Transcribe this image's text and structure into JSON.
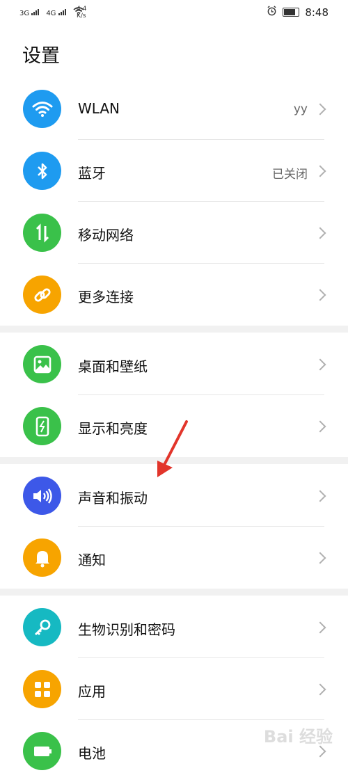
{
  "status_bar": {
    "net1": "3G",
    "net2": "4G",
    "speed_value": "4.4",
    "speed_unit": "K/s",
    "time": "8:48"
  },
  "page": {
    "title": "设置"
  },
  "rows": [
    {
      "label": "WLAN",
      "value": "yy",
      "icon": "wifi-icon",
      "color": "#1e9bf0"
    },
    {
      "label": "蓝牙",
      "value": "已关闭",
      "icon": "bluetooth-icon",
      "color": "#1e9bf0"
    },
    {
      "label": "移动网络",
      "value": "",
      "icon": "mobile-data-icon",
      "color": "#3ac14a"
    },
    {
      "label": "更多连接",
      "value": "",
      "icon": "link-icon",
      "color": "#f7a400"
    },
    {
      "label": "桌面和壁纸",
      "value": "",
      "icon": "wallpaper-icon",
      "color": "#3ac14a"
    },
    {
      "label": "显示和亮度",
      "value": "",
      "icon": "display-icon",
      "color": "#3ac14a"
    },
    {
      "label": "声音和振动",
      "value": "",
      "icon": "sound-icon",
      "color": "#3d58e8"
    },
    {
      "label": "通知",
      "value": "",
      "icon": "bell-icon",
      "color": "#f7a400"
    },
    {
      "label": "生物识别和密码",
      "value": "",
      "icon": "key-icon",
      "color": "#16b9c2"
    },
    {
      "label": "应用",
      "value": "",
      "icon": "apps-icon",
      "color": "#f7a400"
    },
    {
      "label": "电池",
      "value": "",
      "icon": "battery-icon",
      "color": "#3ac14a"
    }
  ],
  "watermark": {
    "text": "Bai 经验"
  },
  "colors": {
    "arrow": "#e2352b"
  }
}
